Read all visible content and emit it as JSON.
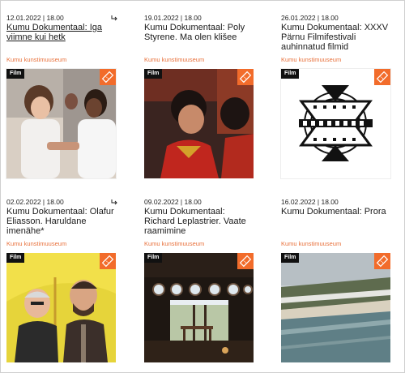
{
  "events": [
    {
      "meta": "12.01.2022 | 18.00",
      "title": "Kumu Dokumentaal: Iga viimne kui hetk",
      "venue": "Kumu kunstimuuseum",
      "tag": "Film"
    },
    {
      "meta": "19.01.2022 | 18.00",
      "title": "Kumu Dokumentaal: Poly Styrene. Ma olen klišee",
      "venue": "Kumu kunstimuuseum",
      "tag": "Film"
    },
    {
      "meta": "26.01.2022 | 18.00",
      "title": "Kumu Dokumentaal: XXXV Pärnu Filmifestivali auhinnatud filmid",
      "venue": "Kumu kunstimuuseum",
      "tag": "Film"
    },
    {
      "meta": "02.02.2022 | 18.00",
      "title": "Kumu Dokumentaal: Olafur Eliasson. Haruldane imenähe*",
      "venue": "Kumu kunstimuuseum",
      "tag": "Film"
    },
    {
      "meta": "09.02.2022 | 18.00",
      "title": "Kumu Dokumentaal: Richard Leplastrier. Vaate raamimine",
      "venue": "Kumu kunstimuuseum",
      "tag": "Film"
    },
    {
      "meta": "16.02.2022 | 18.00",
      "title": "Kumu Dokumentaal: Prora",
      "venue": "Kumu kunstimuuseum",
      "tag": "Film"
    }
  ],
  "colors": {
    "accent": "#f26c2b",
    "venue": "#e8703a",
    "tag_bg": "#111111"
  },
  "icons": {
    "arrow": "share-arrow-icon",
    "ticket": "ticket-icon"
  }
}
